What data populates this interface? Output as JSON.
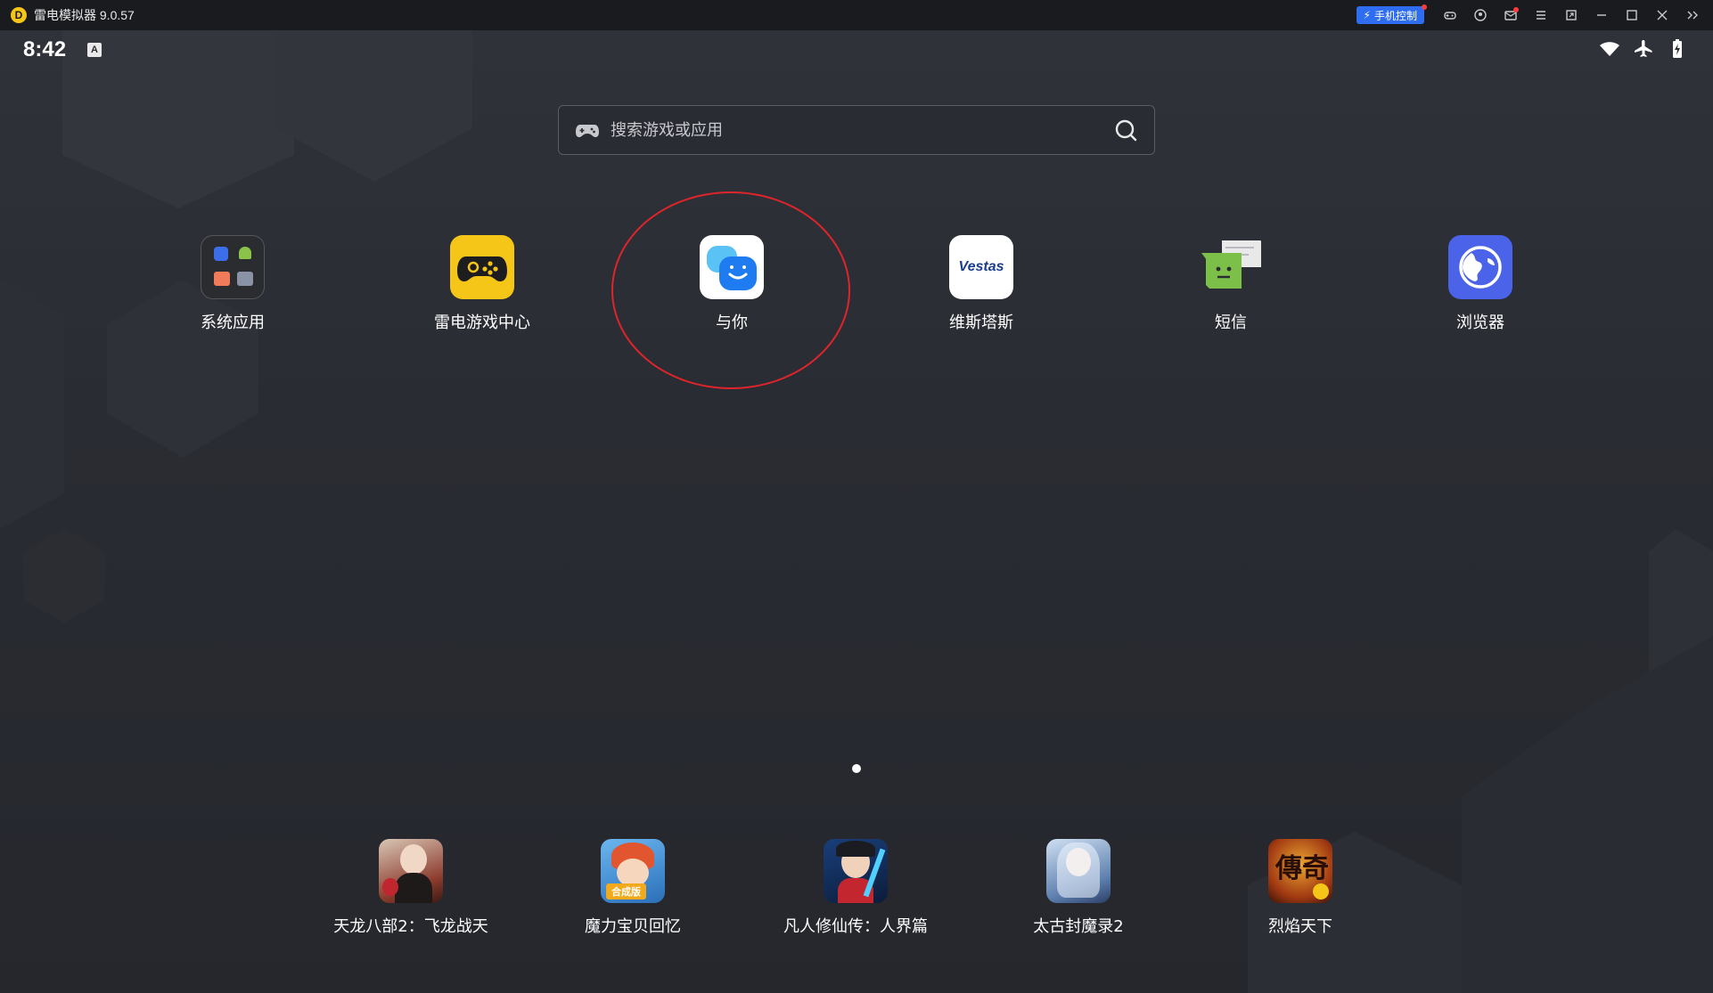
{
  "window": {
    "title": "雷电模拟器 9.0.57",
    "logo_letter": "D",
    "phone_control_label": "手机控制",
    "buttons": [
      "gamepad-icon",
      "account-icon",
      "mail-icon",
      "menu-icon",
      "restore-icon",
      "minimize-icon",
      "maximize-icon",
      "close-icon",
      "collapse-icon"
    ]
  },
  "statusbar": {
    "time": "8:42",
    "ime": "A"
  },
  "search": {
    "placeholder": "搜索游戏或应用"
  },
  "apps": [
    {
      "label": "系统应用",
      "icon": "folder-icon"
    },
    {
      "label": "雷电游戏中心",
      "icon": "gamepad-icon"
    },
    {
      "label": "与你",
      "icon": "chat-face-icon"
    },
    {
      "label": "维斯塔斯",
      "icon": "vestas-logo",
      "logo_text": "Vestas"
    },
    {
      "label": "短信",
      "icon": "sms-icon"
    },
    {
      "label": "浏览器",
      "icon": "globe-icon"
    }
  ],
  "dock": [
    {
      "label": "天龙八部2：飞龙战天"
    },
    {
      "label": "魔力宝贝回忆",
      "badge": "合成版"
    },
    {
      "label": "凡人修仙传：人界篇"
    },
    {
      "label": "太古封魔录2"
    },
    {
      "label": "烈焰天下",
      "badge": "傳奇"
    }
  ],
  "colors": {
    "accent": "#2f6df0",
    "highlight_ring": "#e0242b",
    "game_center_yellow": "#f5c518",
    "browser_blue": "#4a63e8",
    "sms_green": "#7cc04a"
  }
}
